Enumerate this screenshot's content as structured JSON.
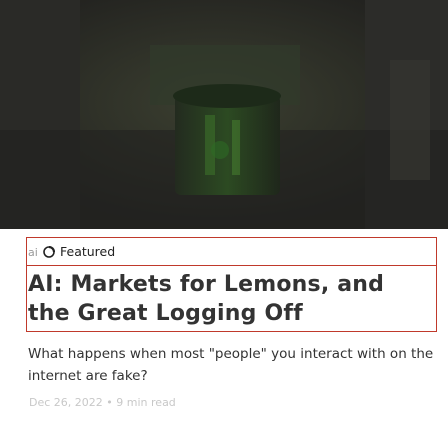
{
  "post": {
    "tag_prefix": "ai",
    "tag_label": "Featured",
    "title": "AI: Markets for Lemons, and the Great Logging Off",
    "excerpt": "What happens when most \"people\" you interact with on the internet are fake?",
    "date": "Dec 26, 2022",
    "separator": "•",
    "read_time": "9 min read"
  },
  "icons": {
    "featured": "star-icon"
  },
  "colors": {
    "focus_outline": "#c0392b",
    "hero_dark": "#2f2f2b",
    "hero_green": "#1c4a1a"
  }
}
